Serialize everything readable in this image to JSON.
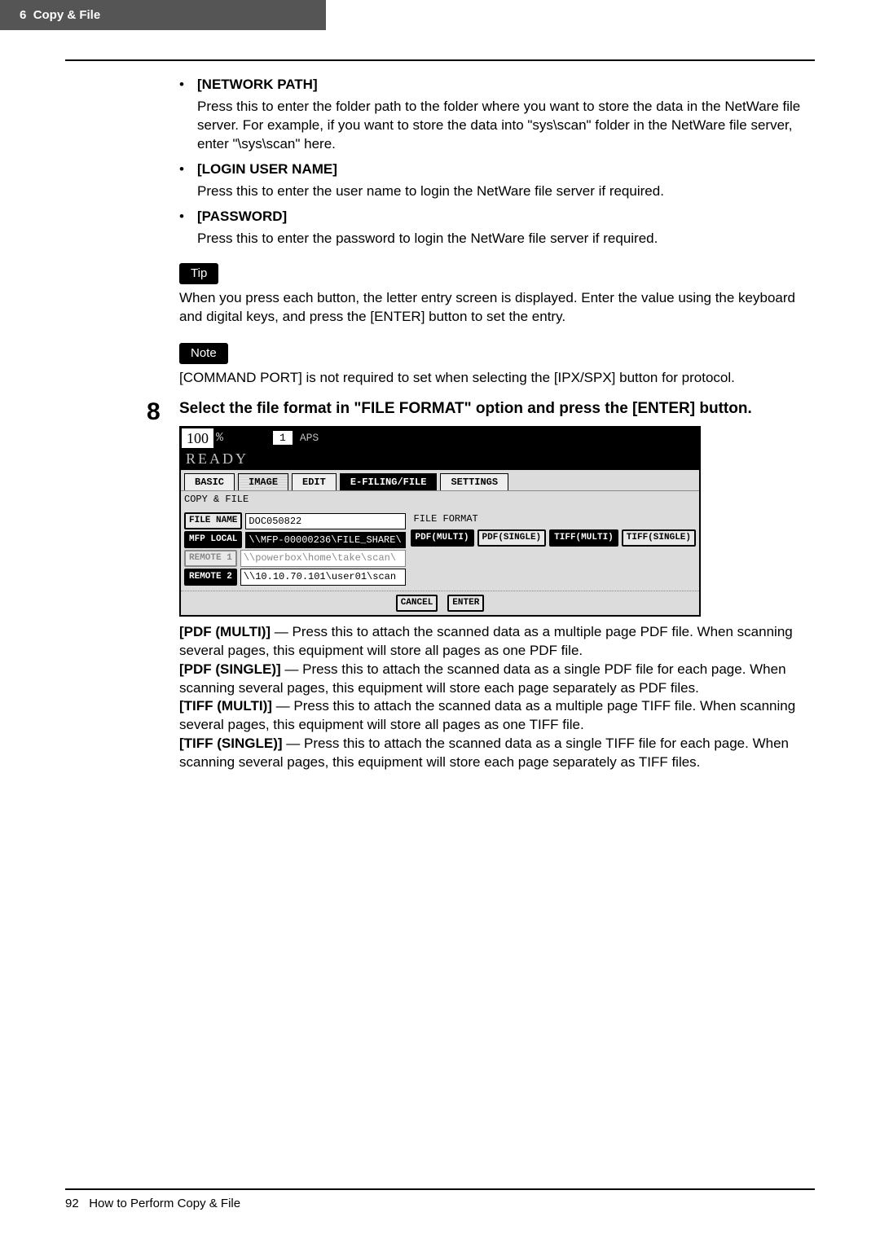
{
  "header": {
    "chapter": "6",
    "title": "Copy & File"
  },
  "bullets": [
    {
      "title": "[NETWORK PATH]",
      "body": "Press this to enter the folder path to the folder where you want to store the data in the NetWare file server.  For example, if you want to store the data into \"sys\\scan\" folder in the NetWare file server, enter \"\\sys\\scan\" here."
    },
    {
      "title": "[LOGIN USER NAME]",
      "body": "Press this to enter the user name to login the NetWare file server if required."
    },
    {
      "title": "[PASSWORD]",
      "body": "Press this to enter the password to login the NetWare file server if required."
    }
  ],
  "tip": {
    "label": "Tip",
    "text": "When you press each button, the letter entry screen is displayed. Enter the value using the keyboard and digital keys, and press the [ENTER] button to set the entry."
  },
  "note": {
    "label": "Note",
    "text": "[COMMAND PORT] is not required to set when selecting the [IPX/SPX] button for protocol."
  },
  "step": {
    "num": "8",
    "title": "Select the file format in \"FILE FORMAT\" option and press the [ENTER] button."
  },
  "panel": {
    "zoom": "100",
    "pct": "%",
    "count": "1",
    "aps": "APS",
    "ready": "READY",
    "tabs": {
      "basic": "BASIC",
      "image": "IMAGE",
      "edit": "EDIT",
      "efiling": "E-FILING/FILE",
      "settings": "SETTINGS"
    },
    "sub": "COPY & FILE",
    "left": {
      "file_name_btn": "FILE NAME",
      "file_name_val": "DOC050822",
      "mfp_btn": "MFP LOCAL",
      "mfp_val": "\\\\MFP-00000236\\FILE_SHARE\\",
      "r1_btn": "REMOTE 1",
      "r1_val": "\\\\powerbox\\home\\take\\scan\\",
      "r2_btn": "REMOTE 2",
      "r2_val": "\\\\10.10.70.101\\user01\\scan"
    },
    "right": {
      "label": "FILE FORMAT",
      "pdf_m": "PDF(MULTI)",
      "pdf_s": "PDF(SINGLE)",
      "tif_m": "TIFF(MULTI)",
      "tif_s": "TIFF(SINGLE)"
    },
    "bottom": {
      "cancel": "CANCEL",
      "enter": "ENTER"
    }
  },
  "desc": {
    "pdf_multi_b": "[PDF (MULTI)]",
    "pdf_multi": " — Press this to attach the scanned data as a multiple page PDF file.  When scanning several pages, this equipment will store all pages as one PDF file.",
    "pdf_single_b": "[PDF (SINGLE)]",
    "pdf_single": " — Press this to attach the scanned data as a single PDF file for each page.  When scanning several pages, this equipment will store each page separately as PDF files.",
    "tiff_multi_b": "[TIFF (MULTI)]",
    "tiff_multi": " — Press this to attach the scanned data as a multiple page TIFF file.  When scanning several pages, this equipment will store all pages as one TIFF file.",
    "tiff_single_b": "[TIFF (SINGLE)]",
    "tiff_single": " — Press this to attach the scanned data as a single TIFF file for each page.  When scanning several pages, this equipment will store each page separately as TIFF files."
  },
  "footer": {
    "page": "92",
    "text": "How to Perform Copy & File"
  }
}
